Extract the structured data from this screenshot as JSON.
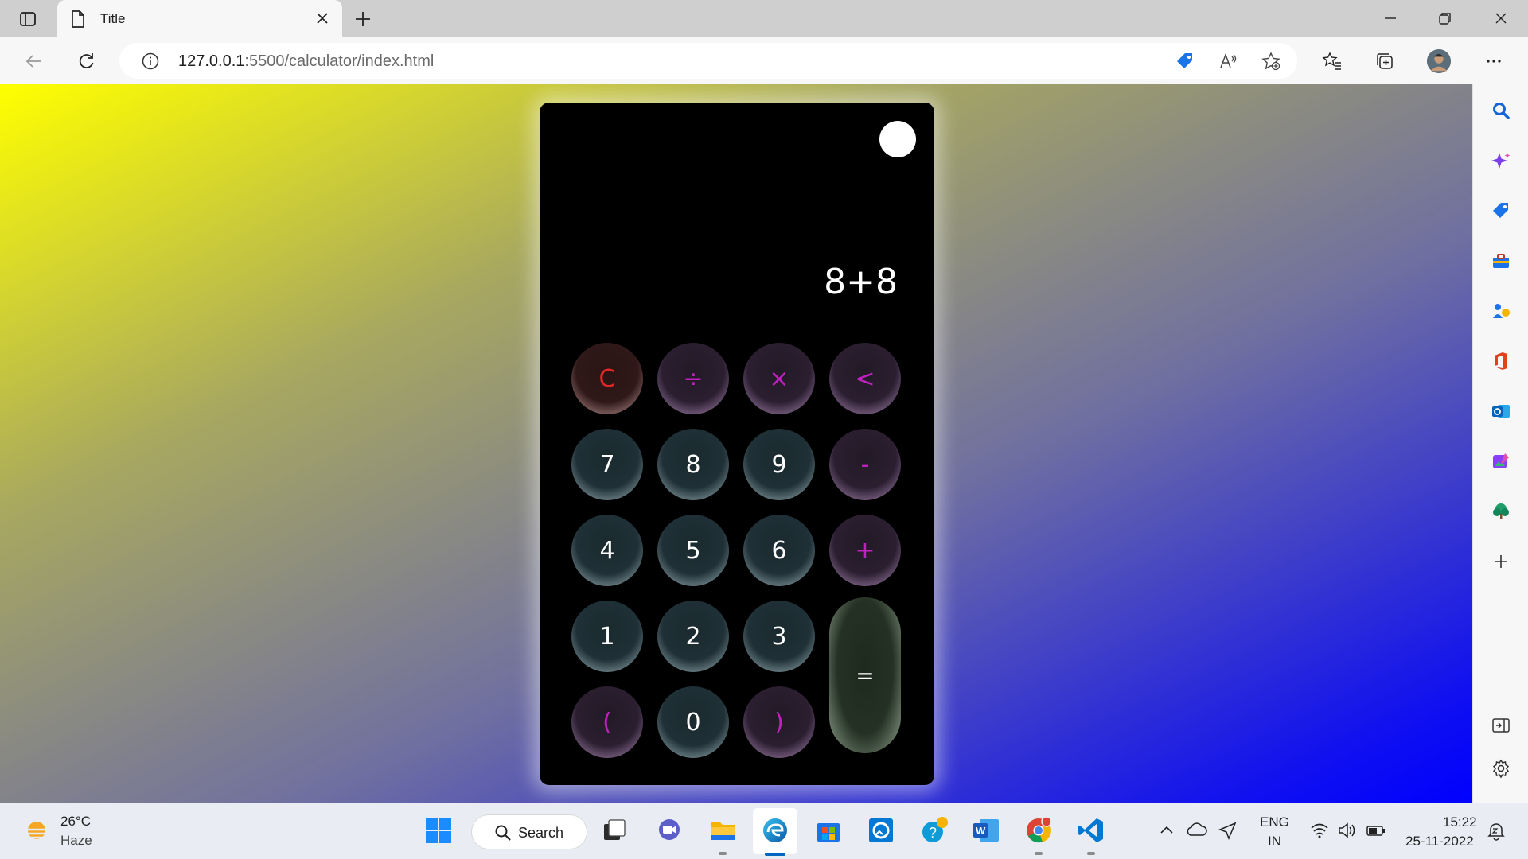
{
  "browser": {
    "tab_title": "Title",
    "url_host": "127.0.0.1",
    "url_rest": ":5500/calculator/index.html"
  },
  "calculator": {
    "display": "8+8",
    "keys": {
      "clear": "C",
      "divide": "÷",
      "multiply": "×",
      "backspace": "<",
      "seven": "7",
      "eight": "8",
      "nine": "9",
      "minus": "-",
      "four": "4",
      "five": "5",
      "six": "6",
      "plus": "+",
      "one": "1",
      "two": "2",
      "three": "3",
      "equals": "=",
      "open_paren": "(",
      "zero": "0",
      "close_paren": ")"
    },
    "colors": {
      "number_text": "#ffffff",
      "operator_text": "#c020c0",
      "clear_text": "#e02828"
    }
  },
  "taskbar": {
    "weather_temp": "26°C",
    "weather_condition": "Haze",
    "search_label": "Search",
    "language_top": "ENG",
    "language_bottom": "IN",
    "time": "15:22",
    "date": "25-11-2022"
  }
}
